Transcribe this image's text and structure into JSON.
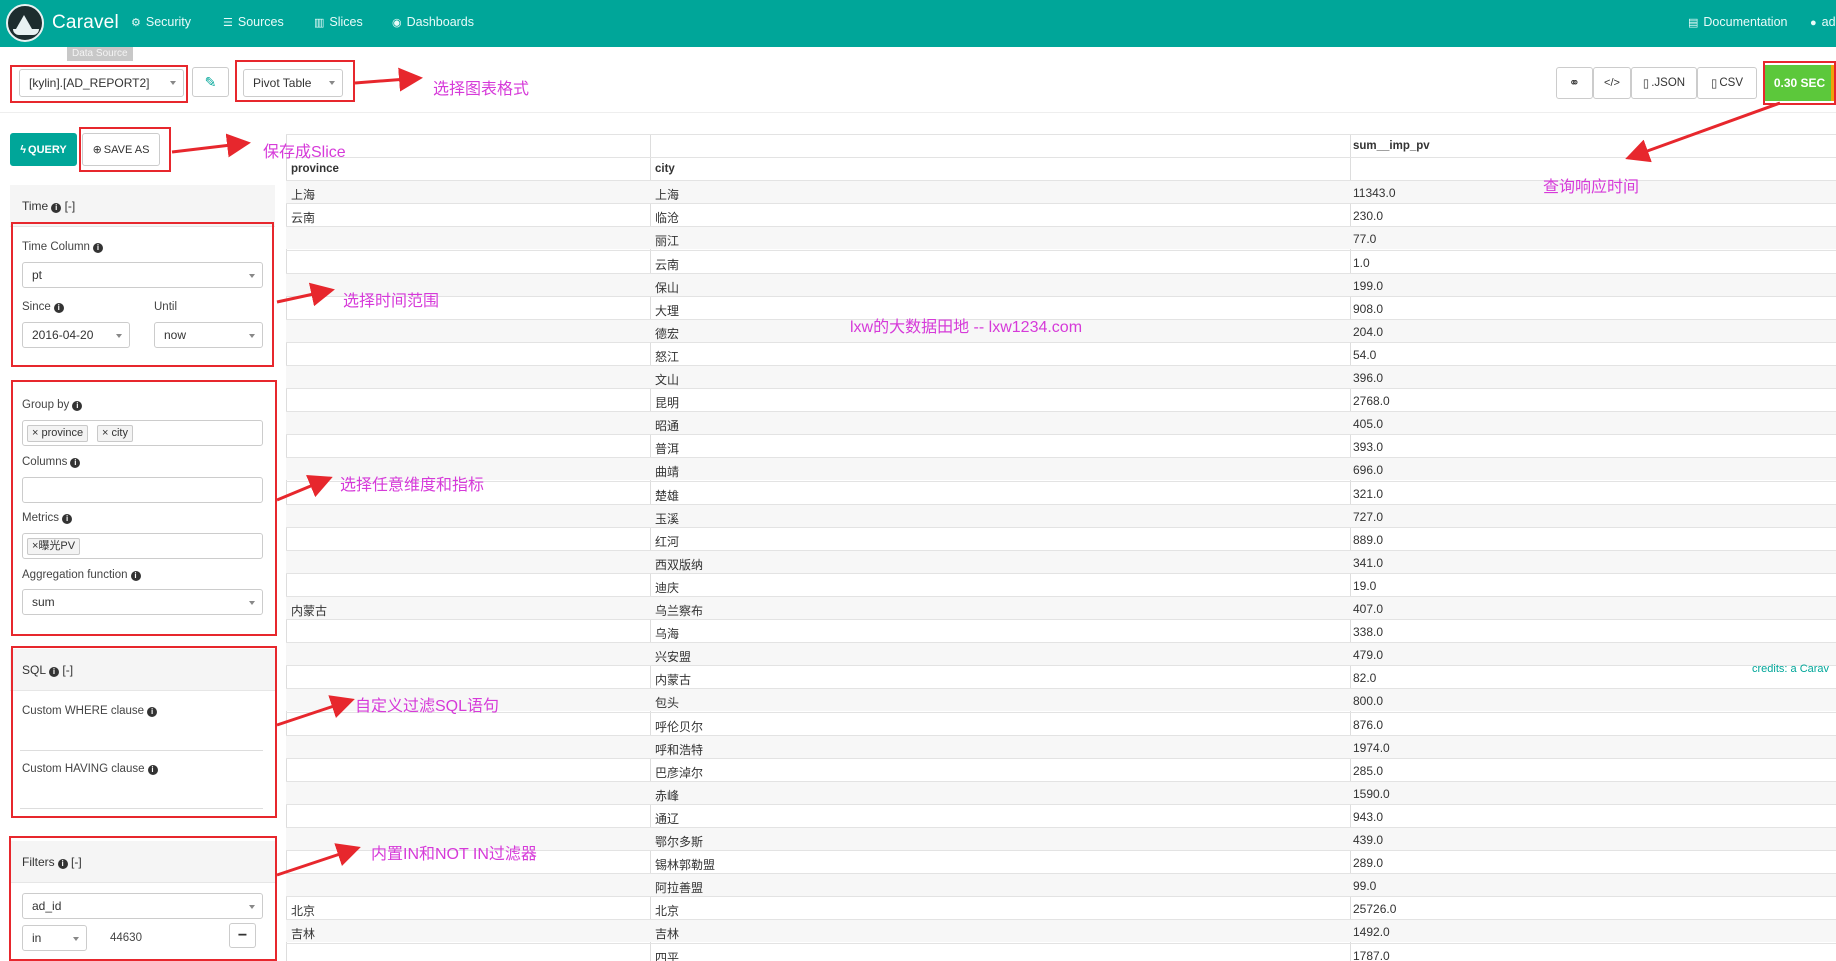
{
  "navbar": {
    "brand": "Caravel",
    "items": [
      {
        "label": "Security",
        "icon": "gear-icon"
      },
      {
        "label": "Sources",
        "icon": "database-icon"
      },
      {
        "label": "Slices",
        "icon": "bar-chart-icon"
      },
      {
        "label": "Dashboards",
        "icon": "dashboard-icon"
      }
    ],
    "documentation": "Documentation",
    "user": "ad",
    "tooltip": "Data Source"
  },
  "toolbar": {
    "datasource": "[kylin].[AD_REPORT2]",
    "viz_type": "Pivot Table",
    "json_label": ".JSON",
    "csv_label": "CSV",
    "timer": "0.30 SEC",
    "query_label": "QUERY",
    "save_as_label": "SAVE AS"
  },
  "annotations": {
    "viz_type": "选择图表格式",
    "save_slice": "保存成Slice",
    "response_time": "查询响应时间",
    "time_range": "选择时间范围",
    "dimensions": "选择任意维度和指标",
    "sql_filter": "自定义过滤SQL语句",
    "in_filter": "内置IN和NOT IN过滤器",
    "watermark": "lxw的大数据田地 -- lxw1234.com"
  },
  "sidebar": {
    "time": {
      "title": "Time",
      "toggle": "[-]",
      "time_column_label": "Time Column",
      "time_column": "pt",
      "since_label": "Since",
      "since": "2016-04-20",
      "until_label": "Until",
      "until": "now"
    },
    "groupby": {
      "label": "Group by",
      "tags": [
        "province",
        "city"
      ],
      "columns_label": "Columns",
      "metrics_label": "Metrics",
      "metrics_tags": [
        "曝光PV"
      ],
      "agg_label": "Aggregation function",
      "agg": "sum"
    },
    "sql": {
      "title": "SQL",
      "toggle": "[-]",
      "where_label": "Custom WHERE clause",
      "having_label": "Custom HAVING clause"
    },
    "filters": {
      "title": "Filters",
      "toggle": "[-]",
      "column": "ad_id",
      "op": "in",
      "value": "44630"
    }
  },
  "table": {
    "metric_header": "sum__imp_pv",
    "col1": "province",
    "col2": "city",
    "rows": [
      {
        "province": "上海",
        "city": "上海",
        "value": "11343.0"
      },
      {
        "province": "云南",
        "city": "临沧",
        "value": "230.0"
      },
      {
        "province": "",
        "city": "丽江",
        "value": "77.0"
      },
      {
        "province": "",
        "city": "云南",
        "value": "1.0"
      },
      {
        "province": "",
        "city": "保山",
        "value": "199.0"
      },
      {
        "province": "",
        "city": "大理",
        "value": "908.0"
      },
      {
        "province": "",
        "city": "德宏",
        "value": "204.0"
      },
      {
        "province": "",
        "city": "怒江",
        "value": "54.0"
      },
      {
        "province": "",
        "city": "文山",
        "value": "396.0"
      },
      {
        "province": "",
        "city": "昆明",
        "value": "2768.0"
      },
      {
        "province": "",
        "city": "昭通",
        "value": "405.0"
      },
      {
        "province": "",
        "city": "普洱",
        "value": "393.0"
      },
      {
        "province": "",
        "city": "曲靖",
        "value": "696.0"
      },
      {
        "province": "",
        "city": "楚雄",
        "value": "321.0"
      },
      {
        "province": "",
        "city": "玉溪",
        "value": "727.0"
      },
      {
        "province": "",
        "city": "红河",
        "value": "889.0"
      },
      {
        "province": "",
        "city": "西双版纳",
        "value": "341.0"
      },
      {
        "province": "",
        "city": "迪庆",
        "value": "19.0"
      },
      {
        "province": "内蒙古",
        "city": "乌兰察布",
        "value": "407.0"
      },
      {
        "province": "",
        "city": "乌海",
        "value": "338.0"
      },
      {
        "province": "",
        "city": "兴安盟",
        "value": "479.0"
      },
      {
        "province": "",
        "city": "内蒙古",
        "value": "82.0"
      },
      {
        "province": "",
        "city": "包头",
        "value": "800.0"
      },
      {
        "province": "",
        "city": "呼伦贝尔",
        "value": "876.0"
      },
      {
        "province": "",
        "city": "呼和浩特",
        "value": "1974.0"
      },
      {
        "province": "",
        "city": "巴彦淖尔",
        "value": "285.0"
      },
      {
        "province": "",
        "city": "赤峰",
        "value": "1590.0"
      },
      {
        "province": "",
        "city": "通辽",
        "value": "943.0"
      },
      {
        "province": "",
        "city": "鄂尔多斯",
        "value": "439.0"
      },
      {
        "province": "",
        "city": "锡林郭勒盟",
        "value": "289.0"
      },
      {
        "province": "",
        "city": "阿拉善盟",
        "value": "99.0"
      },
      {
        "province": "北京",
        "city": "北京",
        "value": "25726.0"
      },
      {
        "province": "吉林",
        "city": "吉林",
        "value": "1492.0"
      },
      {
        "province": "",
        "city": "四平",
        "value": "1787.0"
      }
    ]
  },
  "credits": {
    "prefix": "credits: a",
    "link": "Carav"
  }
}
